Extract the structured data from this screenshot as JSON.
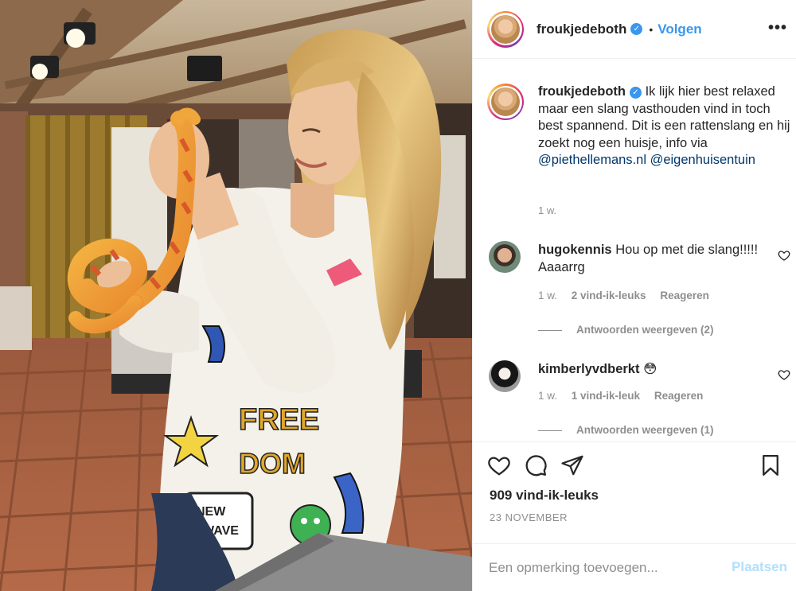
{
  "post": {
    "username": "froukjedeboth",
    "verified_icon": "verified-badge-icon",
    "separator": "•",
    "follow_label": "Volgen",
    "more_label": "•••"
  },
  "caption": {
    "username": "froukjedeboth",
    "text": "Ik lijk hier best relaxed maar een slang vasthouden vind in toch best spannend. Dit is een rattenslang en hij zoekt nog een huisje, info via",
    "mention_1": "@piethellemans.nl",
    "mention_2": "@eigenhuisentuin",
    "time": "1 w."
  },
  "comments": [
    {
      "username": "hugokennis",
      "text": "Hou op met die slang!!!!! Aaaarrg",
      "time": "1 w.",
      "likes": "2 vind-ik-leuks",
      "reply_label": "Reageren",
      "view_replies": "Antwoorden weergeven (2)"
    },
    {
      "username": "kimberlyvdberkt",
      "text": "😳",
      "time": "1 w.",
      "likes": "1 vind-ik-leuk",
      "reply_label": "Reageren",
      "view_replies": "Antwoorden weergeven (1)"
    }
  ],
  "stats": {
    "likes": "909 vind-ik-leuks",
    "date": "23 NOVEMBER"
  },
  "add_comment": {
    "placeholder": "Een opmerking toevoegen...",
    "post_label": "Plaatsen"
  },
  "photo_text": {
    "free": "FREE",
    "dom": "DOM",
    "new": "NEW",
    "wave": "WAVE"
  },
  "colors": {
    "link": "#00376b",
    "accent": "#3897f0",
    "post_disabled": "#b2dffc",
    "muted": "#8e8e8e"
  }
}
